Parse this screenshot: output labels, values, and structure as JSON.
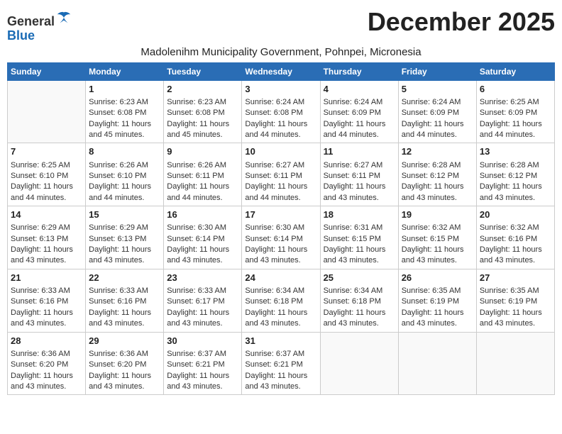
{
  "header": {
    "logo_general": "General",
    "logo_blue": "Blue",
    "month_title": "December 2025",
    "subtitle": "Madolenihm Municipality Government, Pohnpei, Micronesia"
  },
  "calendar": {
    "days_of_week": [
      "Sunday",
      "Monday",
      "Tuesday",
      "Wednesday",
      "Thursday",
      "Friday",
      "Saturday"
    ],
    "weeks": [
      [
        {
          "day": "",
          "content": ""
        },
        {
          "day": "1",
          "content": "Sunrise: 6:23 AM\nSunset: 6:08 PM\nDaylight: 11 hours\nand 45 minutes."
        },
        {
          "day": "2",
          "content": "Sunrise: 6:23 AM\nSunset: 6:08 PM\nDaylight: 11 hours\nand 45 minutes."
        },
        {
          "day": "3",
          "content": "Sunrise: 6:24 AM\nSunset: 6:08 PM\nDaylight: 11 hours\nand 44 minutes."
        },
        {
          "day": "4",
          "content": "Sunrise: 6:24 AM\nSunset: 6:09 PM\nDaylight: 11 hours\nand 44 minutes."
        },
        {
          "day": "5",
          "content": "Sunrise: 6:24 AM\nSunset: 6:09 PM\nDaylight: 11 hours\nand 44 minutes."
        },
        {
          "day": "6",
          "content": "Sunrise: 6:25 AM\nSunset: 6:09 PM\nDaylight: 11 hours\nand 44 minutes."
        }
      ],
      [
        {
          "day": "7",
          "content": "Sunrise: 6:25 AM\nSunset: 6:10 PM\nDaylight: 11 hours\nand 44 minutes."
        },
        {
          "day": "8",
          "content": "Sunrise: 6:26 AM\nSunset: 6:10 PM\nDaylight: 11 hours\nand 44 minutes."
        },
        {
          "day": "9",
          "content": "Sunrise: 6:26 AM\nSunset: 6:11 PM\nDaylight: 11 hours\nand 44 minutes."
        },
        {
          "day": "10",
          "content": "Sunrise: 6:27 AM\nSunset: 6:11 PM\nDaylight: 11 hours\nand 44 minutes."
        },
        {
          "day": "11",
          "content": "Sunrise: 6:27 AM\nSunset: 6:11 PM\nDaylight: 11 hours\nand 43 minutes."
        },
        {
          "day": "12",
          "content": "Sunrise: 6:28 AM\nSunset: 6:12 PM\nDaylight: 11 hours\nand 43 minutes."
        },
        {
          "day": "13",
          "content": "Sunrise: 6:28 AM\nSunset: 6:12 PM\nDaylight: 11 hours\nand 43 minutes."
        }
      ],
      [
        {
          "day": "14",
          "content": "Sunrise: 6:29 AM\nSunset: 6:13 PM\nDaylight: 11 hours\nand 43 minutes."
        },
        {
          "day": "15",
          "content": "Sunrise: 6:29 AM\nSunset: 6:13 PM\nDaylight: 11 hours\nand 43 minutes."
        },
        {
          "day": "16",
          "content": "Sunrise: 6:30 AM\nSunset: 6:14 PM\nDaylight: 11 hours\nand 43 minutes."
        },
        {
          "day": "17",
          "content": "Sunrise: 6:30 AM\nSunset: 6:14 PM\nDaylight: 11 hours\nand 43 minutes."
        },
        {
          "day": "18",
          "content": "Sunrise: 6:31 AM\nSunset: 6:15 PM\nDaylight: 11 hours\nand 43 minutes."
        },
        {
          "day": "19",
          "content": "Sunrise: 6:32 AM\nSunset: 6:15 PM\nDaylight: 11 hours\nand 43 minutes."
        },
        {
          "day": "20",
          "content": "Sunrise: 6:32 AM\nSunset: 6:16 PM\nDaylight: 11 hours\nand 43 minutes."
        }
      ],
      [
        {
          "day": "21",
          "content": "Sunrise: 6:33 AM\nSunset: 6:16 PM\nDaylight: 11 hours\nand 43 minutes."
        },
        {
          "day": "22",
          "content": "Sunrise: 6:33 AM\nSunset: 6:16 PM\nDaylight: 11 hours\nand 43 minutes."
        },
        {
          "day": "23",
          "content": "Sunrise: 6:33 AM\nSunset: 6:17 PM\nDaylight: 11 hours\nand 43 minutes."
        },
        {
          "day": "24",
          "content": "Sunrise: 6:34 AM\nSunset: 6:18 PM\nDaylight: 11 hours\nand 43 minutes."
        },
        {
          "day": "25",
          "content": "Sunrise: 6:34 AM\nSunset: 6:18 PM\nDaylight: 11 hours\nand 43 minutes."
        },
        {
          "day": "26",
          "content": "Sunrise: 6:35 AM\nSunset: 6:19 PM\nDaylight: 11 hours\nand 43 minutes."
        },
        {
          "day": "27",
          "content": "Sunrise: 6:35 AM\nSunset: 6:19 PM\nDaylight: 11 hours\nand 43 minutes."
        }
      ],
      [
        {
          "day": "28",
          "content": "Sunrise: 6:36 AM\nSunset: 6:20 PM\nDaylight: 11 hours\nand 43 minutes."
        },
        {
          "day": "29",
          "content": "Sunrise: 6:36 AM\nSunset: 6:20 PM\nDaylight: 11 hours\nand 43 minutes."
        },
        {
          "day": "30",
          "content": "Sunrise: 6:37 AM\nSunset: 6:21 PM\nDaylight: 11 hours\nand 43 minutes."
        },
        {
          "day": "31",
          "content": "Sunrise: 6:37 AM\nSunset: 6:21 PM\nDaylight: 11 hours\nand 43 minutes."
        },
        {
          "day": "",
          "content": ""
        },
        {
          "day": "",
          "content": ""
        },
        {
          "day": "",
          "content": ""
        }
      ]
    ]
  }
}
